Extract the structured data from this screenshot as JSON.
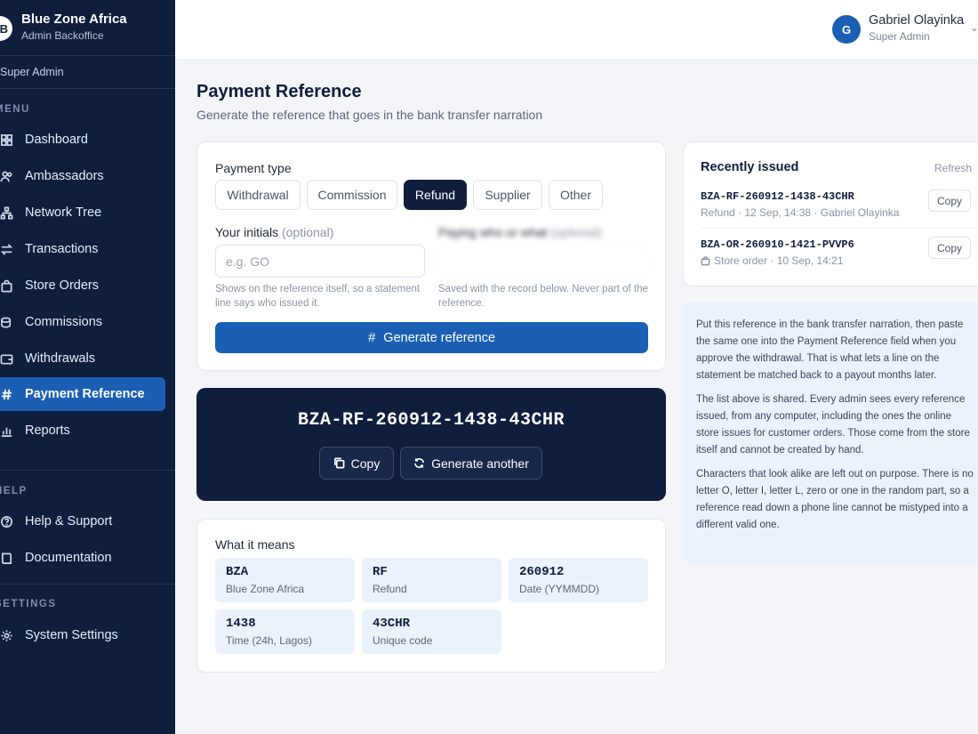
{
  "brand": {
    "name": "Blue Zone Africa",
    "subtitle": "Admin Backoffice",
    "logo_letter": "B"
  },
  "sidebar": {
    "role": "Super Admin",
    "menu_label": "MENU",
    "menu_items": [
      {
        "label": "Dashboard",
        "icon": "grid-icon"
      },
      {
        "label": "Ambassadors",
        "icon": "users-icon"
      },
      {
        "label": "Network Tree",
        "icon": "tree-icon"
      },
      {
        "label": "Transactions",
        "icon": "arrows-icon"
      },
      {
        "label": "Store Orders",
        "icon": "bag-icon"
      },
      {
        "label": "Commissions",
        "icon": "coins-icon"
      },
      {
        "label": "Withdrawals",
        "icon": "wallet-icon"
      },
      {
        "label": "Payment Reference",
        "icon": "hash-icon",
        "active": true
      },
      {
        "label": "Reports",
        "icon": "chart-icon"
      }
    ],
    "help_label": "HELP",
    "help_items": [
      {
        "label": "Help & Support",
        "icon": "help-circle-icon"
      },
      {
        "label": "Documentation",
        "icon": "book-icon"
      }
    ],
    "settings_label": "SETTINGS",
    "settings_items": [
      {
        "label": "System Settings",
        "icon": "gear-icon"
      }
    ]
  },
  "user": {
    "initial": "G",
    "name": "Gabriel Olayinka",
    "role": "Super Admin"
  },
  "page": {
    "title": "Payment Reference",
    "subtitle": "Generate the reference that goes in the bank transfer narration"
  },
  "generator": {
    "payment_type_label": "Payment type",
    "types": [
      "Withdrawal",
      "Commission",
      "Refund",
      "Supplier",
      "Other"
    ],
    "selected_type": "Refund",
    "initials_label": "Your initials",
    "initials_optional": "(optional)",
    "initials_placeholder": "e.g. GO",
    "initials_value": "",
    "initials_hint": "Shows on the reference itself, so a statement line says who issued it.",
    "paying_label": "Paying who or what",
    "paying_optional": "(optional)",
    "paying_hint": "Saved with the record below. Never part of the reference.",
    "generate_label": "Generate reference"
  },
  "result": {
    "code": "BZA-RF-260912-1438-43CHR",
    "copy_label": "Copy",
    "another_label": "Generate another"
  },
  "meaning": {
    "title": "What it means",
    "segments": [
      {
        "code": "BZA",
        "desc": "Blue Zone Africa"
      },
      {
        "code": "RF",
        "desc": "Refund"
      },
      {
        "code": "260912",
        "desc": "Date (YYMMDD)"
      },
      {
        "code": "1438",
        "desc": "Time (24h, Lagos)"
      },
      {
        "code": "43CHR",
        "desc": "Unique code"
      }
    ]
  },
  "recent": {
    "title": "Recently issued",
    "refresh_label": "Refresh",
    "items": [
      {
        "code": "BZA-RF-260912-1438-43CHR",
        "meta": "Refund · 12 Sep, 14:38 · Gabriel Olayinka",
        "copy_label": "Copy"
      },
      {
        "code": "BZA-OR-260910-1421-PVVP6",
        "meta": "Store order · 10 Sep, 14:21",
        "copy_label": "Copy"
      }
    ]
  },
  "info": {
    "paragraphs": [
      "Put this reference in the bank transfer narration, then paste the same one into the Payment Reference field when you approve the withdrawal. That is what lets a line on the statement be matched back to a payout months later.",
      "The list above is shared. Every admin sees every reference issued, from any computer, including the ones the online store issues for customer orders. Those come from the store itself and cannot be created by hand.",
      "Characters that look alike are left out on purpose. There is no letter O, letter I, letter L, zero or one in the random part, so a reference read down a phone line cannot be mistyped into a different valid one."
    ]
  }
}
